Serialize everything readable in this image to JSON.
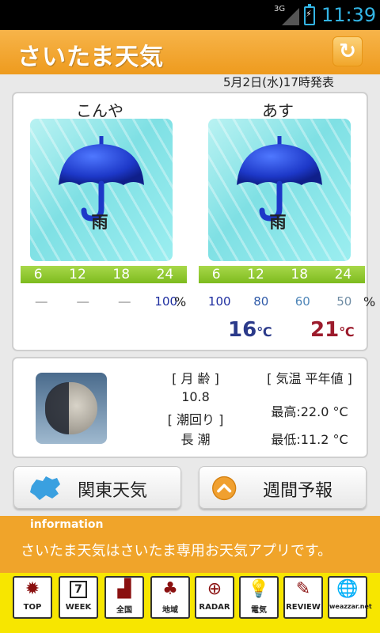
{
  "status": {
    "network": "3G",
    "time": "11:39"
  },
  "header": {
    "title": "さいたま天気",
    "refresh_icon": "refresh-icon"
  },
  "issued": "5月2日(水)17時発表",
  "forecast": [
    {
      "day": "こんや",
      "weather": "雨",
      "icon": "umbrella-icon",
      "hours": [
        "6",
        "12",
        "18",
        "24"
      ],
      "probs": [
        "―",
        "―",
        "―",
        "100"
      ],
      "temp": "16"
    },
    {
      "day": "あす",
      "weather": "雨",
      "icon": "umbrella-icon",
      "hours": [
        "6",
        "12",
        "18",
        "24"
      ],
      "probs": [
        "100",
        "80",
        "60",
        "50"
      ],
      "temp": "21"
    }
  ],
  "percent_unit": "%",
  "temp_unit": "℃",
  "moon": {
    "age_label": "[ 月 齢 ]",
    "age_value": "10.8",
    "tide_label": "[ 潮回り ]",
    "tide_value": "長 潮",
    "normal_label": "[ 気温 平年値 ]",
    "high": "最高:22.0 °C",
    "low": "最低:11.2 °C"
  },
  "buttons": {
    "kanto": "関東天気",
    "weekly": "週間予報"
  },
  "info": {
    "title": "information",
    "message": "さいたま天気はさいたま専用お天気アプリです。"
  },
  "nav": [
    {
      "label": "TOP",
      "icon": "sun-icon"
    },
    {
      "label": "WEEK",
      "icon": "calendar-icon",
      "num": "7"
    },
    {
      "label": "全国",
      "icon": "japan-map-icon"
    },
    {
      "label": "地域",
      "icon": "hokkaido-map-icon"
    },
    {
      "label": "RADAR",
      "icon": "radar-icon"
    },
    {
      "label": "電気",
      "icon": "lightbulb-icon"
    },
    {
      "label": "REVIEW",
      "icon": "pencil-icon"
    },
    {
      "label": "weazzar.net",
      "icon": "globe-icon"
    }
  ],
  "colors": {
    "header": "#f0a42a",
    "low_temp": "#2b3a8a",
    "high_temp": "#9c1b2c",
    "hour_bar": "#8dc63f",
    "nav_bg": "#f7e600"
  }
}
